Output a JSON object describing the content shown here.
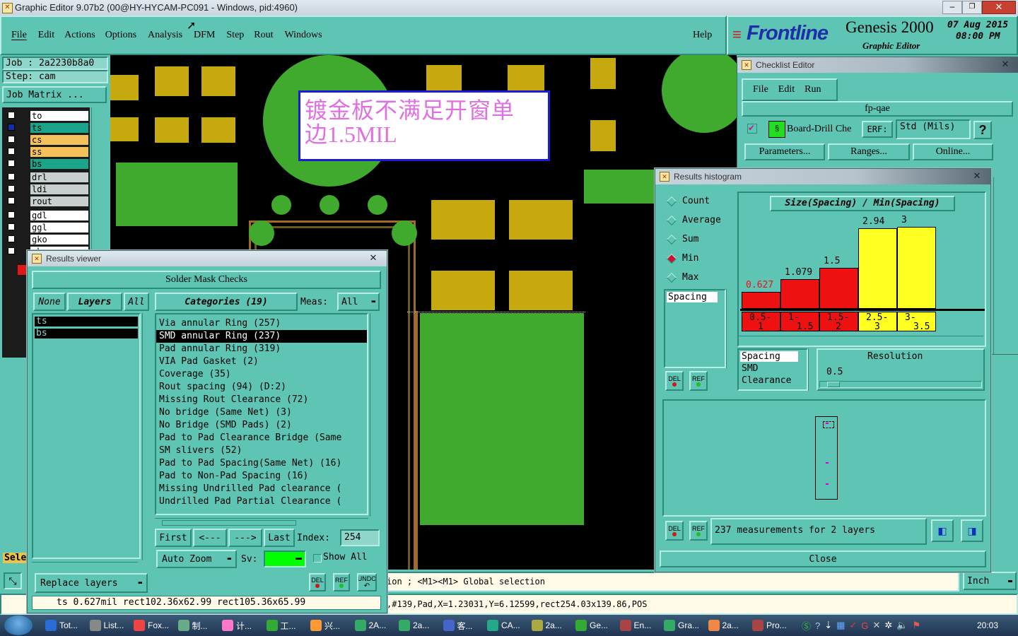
{
  "window": {
    "title": "Graphic Editor 9.07b2 (00@HY-HYCAM-PC091 - Windows, pid:4960)"
  },
  "menu": {
    "items": [
      "File",
      "Edit",
      "Actions",
      "Options",
      "Analysis",
      "DFM",
      "Step",
      "Rout",
      "Windows"
    ],
    "help": "Help"
  },
  "brand": {
    "logo": "Frontline",
    "product": "Genesis 2000",
    "subtitle": "Graphic Editor",
    "date": "07 Aug 2015",
    "time": "08:00 PM"
  },
  "job": {
    "job_line": "Job : 2a2230b8a0",
    "step_line": "Step: cam",
    "matrix_button": "Job Matrix ..."
  },
  "layers": [
    {
      "name": "to",
      "color": "#ffffff"
    },
    {
      "name": "ts",
      "color": "#1aa58a"
    },
    {
      "name": "cs",
      "color": "#f5c15a"
    },
    {
      "name": "ss",
      "color": "#f5c15a"
    },
    {
      "name": "bs",
      "color": "#1aa58a"
    },
    {
      "name": "drl",
      "color": "#c7cfcf"
    },
    {
      "name": "ldi",
      "color": "#c7cfcf"
    },
    {
      "name": "rout",
      "color": "#c7cfcf"
    },
    {
      "name": "gdl",
      "color": "#ffffff"
    },
    {
      "name": "ggl",
      "color": "#ffffff"
    },
    {
      "name": "gko",
      "color": "#ffffff"
    },
    {
      "name": "gb",
      "color": "#ffffff"
    }
  ],
  "left_bottom": {
    "select_label": "Sele"
  },
  "annotation": {
    "line1": "镀金板不满足开窗单",
    "line2": "边1.5MIL"
  },
  "results_viewer": {
    "title": "Results viewer",
    "header": "Solder Mask Checks",
    "none_btn": "None",
    "layers_btn": "Layers",
    "all_btn": "All",
    "categories_label": "Categories (19)",
    "meas_label": "Meas:",
    "meas_value": "All",
    "layer_items": [
      "ts",
      "bs"
    ],
    "categories": [
      "Via annular Ring (257)",
      "SMD annular Ring (237)",
      "Pad annular Ring (319)",
      "VIA Pad Gasket (2)",
      "Coverage (35)",
      "Rout spacing (94)          (D:2)",
      "Missing Rout Clearance (72)",
      "No bridge (Same Net) (3)",
      "No Bridge (SMD Pads) (2)",
      "Pad to Pad Clearance Bridge (Same",
      "SM slivers (52)",
      "Pad to Pad Spacing(Same Net) (16)",
      "Pad to Non-Pad Spacing (16)",
      "Missing Undrilled Pad clearance (",
      "Undrilled Pad Partial Clearance ("
    ],
    "selected_index": 1,
    "first_btn": "First",
    "prev_btn": "<---",
    "next_btn": "--->",
    "last_btn": "Last",
    "index_label": "Index:",
    "index_value": "254",
    "auto_zoom": "Auto Zoom",
    "sv_label": "Sv:",
    "show_all": "Show All",
    "replace_layers": "Replace layers",
    "del": "DEL",
    "ref": "REF",
    "undo": "UNDO"
  },
  "status": {
    "prompt": "ion ; <M1><M1> Global selection",
    "units": "Inch",
    "measure": "ts 0.627mil  rect102.36x62.99  rect105.36x65.99",
    "feature": ",#139,Pad,X=1.23031,Y=6.12599,rect254.03x139.86,POS"
  },
  "checklist": {
    "title": "Checklist Editor",
    "menu": [
      "File",
      "Edit",
      "Run"
    ],
    "name": "fp-qae",
    "action": "Board-Drill Che",
    "erf_label": "ERF:",
    "erf_value": "Std (Mils)",
    "help": "?",
    "parameters": "Parameters...",
    "ranges": "Ranges...",
    "online": "Online..."
  },
  "histogram": {
    "title": "Results histogram",
    "stats": [
      "Count",
      "Average",
      "Sum",
      "Min",
      "Max"
    ],
    "selected_stat": "Min",
    "measure_list": [
      "Spacing"
    ],
    "chart_title": "Size(Spacing) / Min(Spacing)",
    "bins": [
      {
        "range": "0.5-1",
        "value": 0.627,
        "label": "0.627",
        "color": "#ee1111",
        "label_color": "#ee1111"
      },
      {
        "range": "1-1.5",
        "value": 1.079,
        "label": "1.079",
        "color": "#ee1111",
        "label_color": "#000000"
      },
      {
        "range": "1.5-2",
        "value": 1.5,
        "label": "1.5",
        "color": "#ee1111",
        "label_color": "#000000"
      },
      {
        "range": "2.5-3",
        "value": 2.94,
        "label": "2.94",
        "color": "#ffff22",
        "label_color": "#000000"
      },
      {
        "range": "3-3.5",
        "value": 3,
        "label": "3",
        "color": "#ffff22",
        "label_color": "#000000"
      }
    ],
    "bin_labels": [
      [
        "0.5-",
        "1"
      ],
      [
        "1-",
        "1.5"
      ],
      [
        "1.5-",
        "2"
      ],
      [
        "2.5-",
        "3"
      ],
      [
        "3-",
        "3.5"
      ]
    ],
    "ymax": 3.2,
    "type_list": [
      "Spacing",
      "SMD",
      "Clearance"
    ],
    "resolution_label": "Resolution",
    "resolution_value": "0.5",
    "measurements": "237 measurements for 2 layers",
    "close": "Close",
    "del": "DEL",
    "ref": "REF"
  },
  "taskbar": {
    "items": [
      "Tot...",
      "List...",
      "Fox...",
      "制...",
      "计...",
      "工...",
      "兴...",
      "2A...",
      "2a...",
      "客...",
      "CA...",
      "2a...",
      "Ge...",
      "En...",
      "Gra...",
      "2a...",
      "Pro..."
    ],
    "clock": "20:03"
  }
}
